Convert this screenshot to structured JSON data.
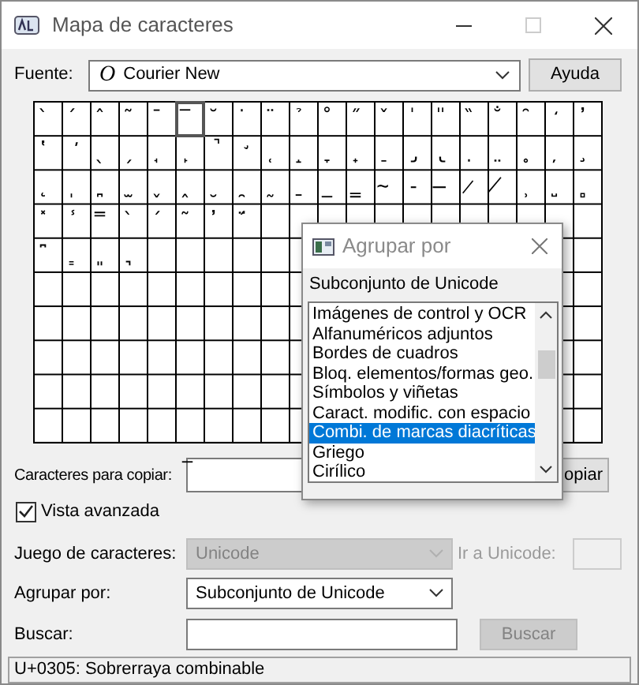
{
  "window": {
    "title": "Mapa de caracteres"
  },
  "font": {
    "label": "Fuente:",
    "icon_text": "O",
    "value": "Courier New"
  },
  "help_button": "Ayuda",
  "grid": {
    "rows": [
      [
        {
          "char": "̀",
          "selected": false
        },
        {
          "char": "́",
          "selected": false
        },
        {
          "char": "̂",
          "selected": false
        },
        {
          "char": "̃",
          "selected": false
        },
        {
          "char": "̄",
          "selected": false
        },
        {
          "char": "̅",
          "selected": true
        },
        {
          "char": "̆",
          "selected": false
        },
        {
          "char": "̇",
          "selected": false
        },
        {
          "char": "̈",
          "selected": false
        },
        {
          "char": "̉",
          "selected": false
        },
        {
          "char": "̊",
          "selected": false
        },
        {
          "char": "̋",
          "selected": false
        },
        {
          "char": "̌",
          "selected": false
        },
        {
          "char": "̍",
          "selected": false
        },
        {
          "char": "̎",
          "selected": false
        },
        {
          "char": "̏",
          "selected": false
        },
        {
          "char": "̐",
          "selected": false
        },
        {
          "char": "̑",
          "selected": false
        },
        {
          "char": "̒",
          "selected": false
        },
        {
          "char": "̓",
          "selected": false
        }
      ],
      [
        {
          "char": "̔",
          "selected": false
        },
        {
          "char": "̕",
          "selected": false
        },
        {
          "char": "̖",
          "selected": false
        },
        {
          "char": "̗",
          "selected": false
        },
        {
          "char": "̘",
          "selected": false
        },
        {
          "char": "̙",
          "selected": false
        },
        {
          "char": "̚",
          "selected": false
        },
        {
          "char": "̛",
          "selected": false
        },
        {
          "char": "̜",
          "selected": false
        },
        {
          "char": "̝",
          "selected": false
        },
        {
          "char": "̞",
          "selected": false
        },
        {
          "char": "̟",
          "selected": false
        },
        {
          "char": "̠",
          "selected": false
        },
        {
          "char": "̡",
          "selected": false
        },
        {
          "char": "̢",
          "selected": false
        },
        {
          "char": "̣",
          "selected": false
        },
        {
          "char": "̤",
          "selected": false
        },
        {
          "char": "̥",
          "selected": false
        },
        {
          "char": "̦",
          "selected": false
        },
        {
          "char": "̧",
          "selected": false
        }
      ],
      [
        {
          "char": "̨",
          "selected": false
        },
        {
          "char": "̩",
          "selected": false
        },
        {
          "char": "̪",
          "selected": false
        },
        {
          "char": "̫",
          "selected": false
        },
        {
          "char": "̬",
          "selected": false
        },
        {
          "char": "̭",
          "selected": false
        },
        {
          "char": "̮",
          "selected": false
        },
        {
          "char": "̯",
          "selected": false
        },
        {
          "char": "̰",
          "selected": false
        },
        {
          "char": "̱",
          "selected": false
        },
        {
          "char": "̲",
          "selected": false
        },
        {
          "char": "̳",
          "selected": false
        },
        {
          "char": "̴",
          "selected": false
        },
        {
          "char": "̵",
          "selected": false
        },
        {
          "char": "̶",
          "selected": false
        },
        {
          "char": "̷",
          "selected": false
        },
        {
          "char": "̸",
          "selected": false
        },
        {
          "char": "̹",
          "selected": false
        },
        {
          "char": "̺",
          "selected": false
        },
        {
          "char": "̻",
          "selected": false
        }
      ],
      [
        {
          "char": "̽",
          "selected": false
        },
        {
          "char": "̾",
          "selected": false
        },
        {
          "char": "̿",
          "selected": false
        },
        {
          "char": "̀",
          "selected": false
        },
        {
          "char": "́",
          "selected": false
        },
        {
          "char": "͂",
          "selected": false
        },
        {
          "char": "̓",
          "selected": false
        },
        {
          "char": "̈́",
          "selected": false
        }
      ],
      [
        {
          "char": "͆",
          "selected": false
        },
        {
          "char": "͇",
          "selected": false
        },
        {
          "char": "͈",
          "selected": false
        },
        {
          "char": "͉",
          "selected": false
        }
      ]
    ]
  },
  "copy": {
    "label": "Caracteres para copiar:",
    "value": "̅",
    "button": "opiar"
  },
  "advanced": {
    "label": "Vista avanzada",
    "checked": true
  },
  "charset": {
    "label": "Juego de caracteres:",
    "value": "Unicode",
    "disabled": true
  },
  "goto_unicode": {
    "label": "Ir a Unicode:",
    "disabled": true
  },
  "group_by": {
    "label": "Agrupar por:",
    "value": "Subconjunto de Unicode"
  },
  "search": {
    "label": "Buscar:",
    "button": "Buscar",
    "button_disabled": true
  },
  "status_bar": "U+0305: Sobrerraya combinable",
  "popup": {
    "title": "Agrupar por",
    "heading": "Subconjunto de Unicode",
    "items": [
      {
        "label": "Imágenes de control y OCR",
        "selected": false
      },
      {
        "label": "Alfanuméricos adjuntos",
        "selected": false
      },
      {
        "label": "Bordes de cuadros",
        "selected": false
      },
      {
        "label": "Bloq. elementos/formas geo.",
        "selected": false
      },
      {
        "label": "Símbolos y viñetas",
        "selected": false
      },
      {
        "label": "Caract. modific. con espacio",
        "selected": false
      },
      {
        "label": "Combi. de marcas diacríticas",
        "selected": true
      },
      {
        "label": "Griego",
        "selected": false
      },
      {
        "label": "Cirílico",
        "selected": false
      }
    ]
  }
}
